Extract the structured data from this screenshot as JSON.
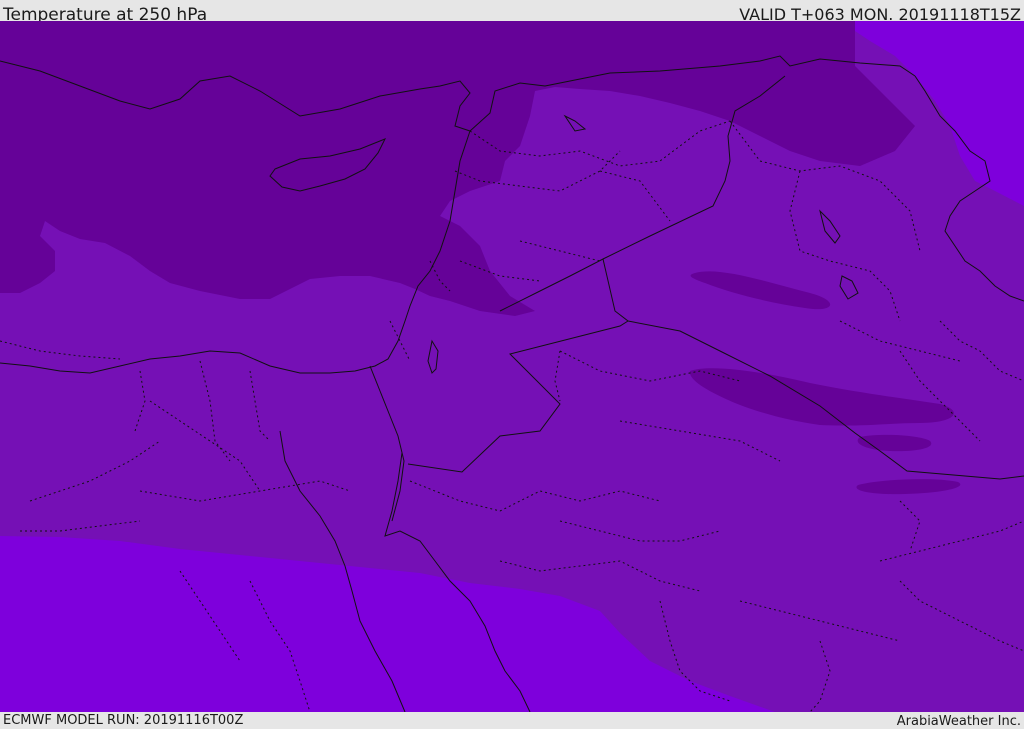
{
  "header": {
    "title": "Temperature at 250 hPa",
    "valid_time": "VALID T+063 MON. 20191118T15Z"
  },
  "footer": {
    "model_run": "ECMWF MODEL RUN: 20191116T00Z",
    "credit": "ArabiaWeather Inc."
  },
  "map": {
    "colors": {
      "cold_band": "#650298",
      "mid_band": "#7510b5",
      "warm_band": "#7e00dc",
      "coastline": "#111111",
      "border": "#111111"
    },
    "icons": {
      "coastline": "coastline-shape",
      "border": "dotted-border-line"
    }
  }
}
